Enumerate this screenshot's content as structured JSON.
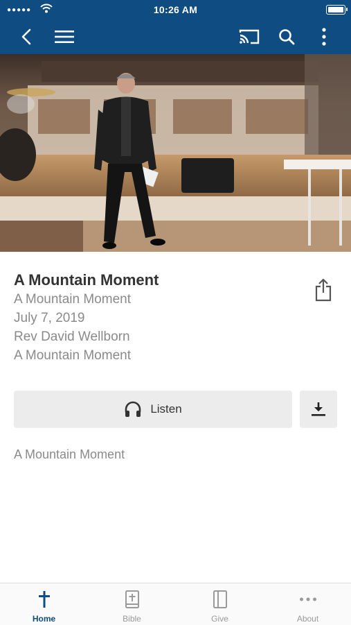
{
  "status_bar": {
    "time": "10:26 AM",
    "signal": "●●●●●"
  },
  "colors": {
    "brand": "#0f4c81",
    "muted_text": "#8a8a8a",
    "button_bg": "#ececec"
  },
  "navbar": {
    "icons": [
      "back-icon",
      "menu-icon",
      "cast-icon",
      "search-icon",
      "more-vertical-icon"
    ]
  },
  "media": {
    "title": "A Mountain Moment",
    "series": "A Mountain Moment",
    "date": "July 7, 2019",
    "speaker": "Rev David Wellborn",
    "category": "A Mountain Moment",
    "listen_label": "Listen",
    "description": "A Mountain Moment"
  },
  "tabbar": {
    "items": [
      {
        "label": "Home",
        "icon": "cross-icon",
        "active": true
      },
      {
        "label": "Bible",
        "icon": "bible-icon",
        "active": false
      },
      {
        "label": "Give",
        "icon": "give-icon",
        "active": false
      },
      {
        "label": "About",
        "icon": "more-horizontal-icon",
        "active": false
      }
    ]
  }
}
